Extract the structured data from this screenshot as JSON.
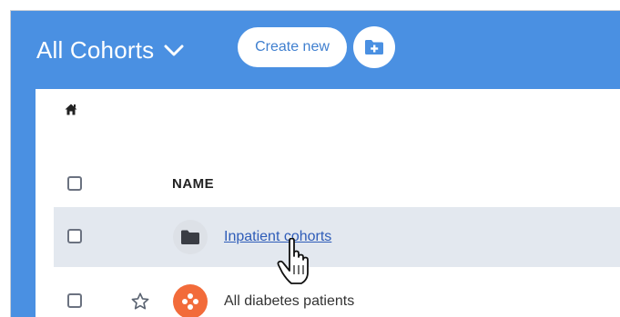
{
  "header": {
    "title": "All Cohorts",
    "create_label": "Create new"
  },
  "breadcrumb": {
    "icon": "home-icon"
  },
  "table": {
    "columns": [
      "NAME"
    ],
    "rows": [
      {
        "label": "Inpatient cohorts",
        "icon": "folder-icon",
        "selected": true,
        "link": true
      },
      {
        "label": "All diabetes patients",
        "icon": "cohort-icon",
        "starred": false,
        "link": false
      }
    ]
  },
  "colors": {
    "header_bg": "#4a90e2",
    "selected_row": "#e3e8ef",
    "cohort_icon": "#f26b3a",
    "link": "#2e5cb8"
  }
}
